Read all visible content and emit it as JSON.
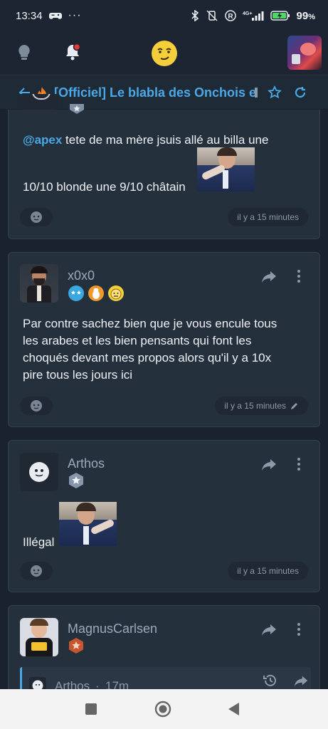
{
  "status_bar": {
    "time": "13:34",
    "battery": "99"
  },
  "topic": {
    "title": "[Officiel] Le blabla des Onchois et d"
  },
  "posts": [
    {
      "text_line1_prefix": "@apex",
      "text_line1": " tete de ma mère jsuis allé au billa une",
      "text_line2": "10/10 blonde une 9/10 châtain",
      "time": "il y a 15 minutes"
    },
    {
      "author": "x0x0",
      "lines": [
        "Par contre sachez bien que je vous encule tous",
        "les arabes et les bien pensants qui font les",
        "choqués devant mes propos alors qu'il y a 10x",
        "pire tous les jours ici"
      ],
      "time": "il y a 15 minutes"
    },
    {
      "author": "Arthos",
      "text": "Illégal",
      "time": "il y a 15 minutes"
    },
    {
      "author": "MagnusCarlsen",
      "quote_author": "Arthos",
      "quote_time": "17m"
    }
  ],
  "colors": {
    "accent": "#4aa8e6",
    "card": "#25303d",
    "background": "#1a222d"
  }
}
